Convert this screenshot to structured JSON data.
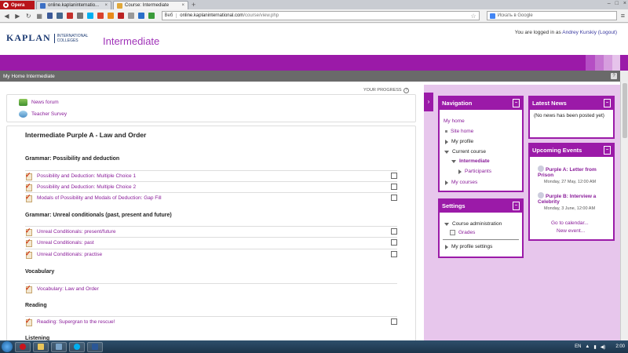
{
  "browser": {
    "opera_label": "Opera",
    "tabs": [
      {
        "label": "online.kaplaninternatio...",
        "close": "×",
        "color": "#3b6fc4"
      },
      {
        "label": "Course: Intermediate",
        "close": "×",
        "color": "#e1a83a"
      }
    ],
    "new_tab": "+",
    "address": {
      "web_label": "Веб",
      "host": "online.kaplaninternational.com",
      "path": "/course/view.php"
    },
    "search_placeholder": "Искать в Google",
    "window_controls": [
      "–",
      "□",
      "×"
    ]
  },
  "header": {
    "brand": "KAPLAN",
    "brand_sub_line1": "INTERNATIONAL",
    "brand_sub_line2": "COLLEGES",
    "course_title": "Intermediate",
    "login_prefix": "You are logged in as",
    "user_name": "Andrey Kurskiy",
    "logout": "(Logout)"
  },
  "navbar": {
    "breadcrumb": "My Home Intermediate",
    "help": "?"
  },
  "main": {
    "your_progress": "YOUR PROGRESS",
    "progress_help": "?",
    "top_resources": [
      {
        "label": "News forum",
        "icon": "forum-icon"
      },
      {
        "label": "Teacher Survey",
        "icon": "survey-icon"
      }
    ],
    "section_title": "Intermediate Purple A - Law and Order",
    "groups": [
      {
        "heading": "Grammar: Possibility and deduction",
        "items": [
          {
            "label": "Possibility and Deduction: Multiple Choice 1",
            "checkbox": true
          },
          {
            "label": "Possibility and Deduction: Multiple Choice 2",
            "checkbox": true
          },
          {
            "label": "Modals of Possibility and Modals of Deduction: Gap Fill",
            "checkbox": true
          }
        ]
      },
      {
        "heading": "Grammar: Unreal conditionals (past, present and future)",
        "items": [
          {
            "label": "Unreal Conditionals: present/future",
            "checkbox": true
          },
          {
            "label": "Unreal Conditionals: past",
            "checkbox": true
          },
          {
            "label": "Unreal Conditionals: practise",
            "checkbox": true
          }
        ]
      },
      {
        "heading": "Vocabulary",
        "items": [
          {
            "label": "Vocabulary: Law and Order",
            "checkbox": false
          }
        ]
      },
      {
        "heading": "Reading",
        "items": [
          {
            "label": "Reading: Supergran to the rescue!",
            "checkbox": true
          }
        ]
      },
      {
        "heading": "Listening",
        "items": []
      }
    ]
  },
  "navigation": {
    "title": "Navigation",
    "control": "–",
    "my_home": "My home",
    "site_home": "Site home",
    "my_profile": "My profile",
    "current_course": "Current course",
    "course": "Intermediate",
    "participants": "Participants",
    "my_courses": "My courses"
  },
  "settings": {
    "title": "Settings",
    "control": "–",
    "course_admin": "Course administration",
    "grades": "Grades",
    "my_profile_settings": "My profile settings"
  },
  "latest_news": {
    "title": "Latest News",
    "control": "–",
    "body": "(No news has been posted yet)"
  },
  "upcoming_events": {
    "title": "Upcoming Events",
    "control": "–",
    "events": [
      {
        "title": "Purple A: Letter from Prison",
        "date": "Monday, 27 May, 12:00 AM"
      },
      {
        "title": "Purple B: Interview a Celebrity",
        "date": "Monday, 3 June, 12:00 AM"
      }
    ],
    "go_to_calendar": "Go to calendar...",
    "new_event": "New event..."
  },
  "taskbar": {
    "lang": "EN",
    "time": "2:00"
  },
  "colors": {
    "accent": "#9b1aa8",
    "link": "#8a1d9a",
    "block_bg": "#e7c6ec"
  }
}
